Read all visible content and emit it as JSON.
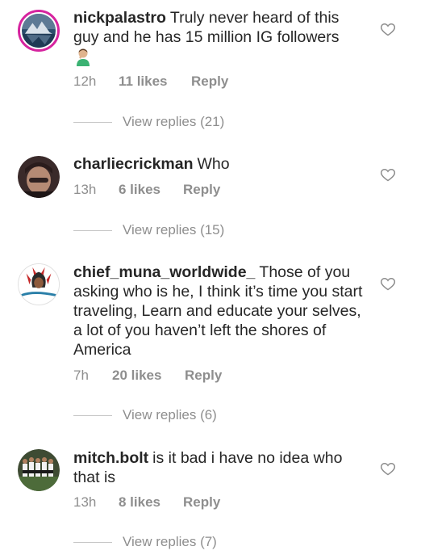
{
  "comments": [
    {
      "username": "nickpalastro",
      "text": "Truly never heard of this guy and he has 15 million IG followers",
      "time": "12h",
      "likes": "11 likes",
      "reply": "Reply",
      "view_replies": "View replies (21)",
      "avatar_icon": "mountain-lake-avatar",
      "emoji_icon": "facepalm-emoji"
    },
    {
      "username": "charliecrickman",
      "text": "Who",
      "time": "13h",
      "likes": "6 likes",
      "reply": "Reply",
      "view_replies": "View replies (15)",
      "avatar_icon": "person-avatar"
    },
    {
      "username": "chief_muna_worldwide_",
      "text": "Those of you asking who is he, I think it’s time you start traveling, Learn and educate your selves, a lot of you haven’t left the shores of America",
      "time": "7h",
      "likes": "20 likes",
      "reply": "Reply",
      "view_replies": "View replies (6)",
      "avatar_icon": "chief-headdress-logo-avatar"
    },
    {
      "username": "mitch.bolt",
      "text": "is it bad i have no idea who that is",
      "time": "13h",
      "likes": "8 likes",
      "reply": "Reply",
      "view_replies": "View replies (7)",
      "avatar_icon": "team-photo-avatar"
    }
  ],
  "colors": {
    "text": "#262626",
    "muted": "#8e8e8e",
    "story_ring": "#d6249f"
  }
}
